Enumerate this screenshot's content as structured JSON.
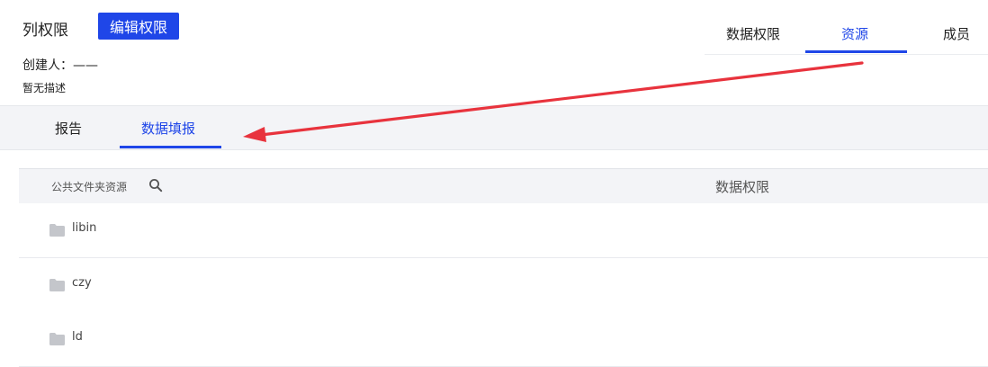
{
  "header": {
    "title": "列权限",
    "edit_button": "编辑权限",
    "creator": "创建人：——",
    "description": "暂无描述"
  },
  "top_tabs": [
    {
      "label": "数据权限",
      "active": false
    },
    {
      "label": "资源",
      "active": true
    },
    {
      "label": "成员",
      "active": false
    }
  ],
  "sub_tabs": [
    {
      "label": "报告",
      "active": false
    },
    {
      "label": "数据填报",
      "active": true
    }
  ],
  "table": {
    "col_resource": "公共文件夹资源",
    "col_permission": "数据权限",
    "rows": [
      {
        "name": "libin",
        "icon": "folder-icon"
      },
      {
        "name": "czy",
        "icon": "folder-icon"
      },
      {
        "name": "ld",
        "icon": "folder-icon"
      }
    ]
  },
  "colors": {
    "accent": "#1f46e8",
    "arrow": "#e8333d"
  }
}
